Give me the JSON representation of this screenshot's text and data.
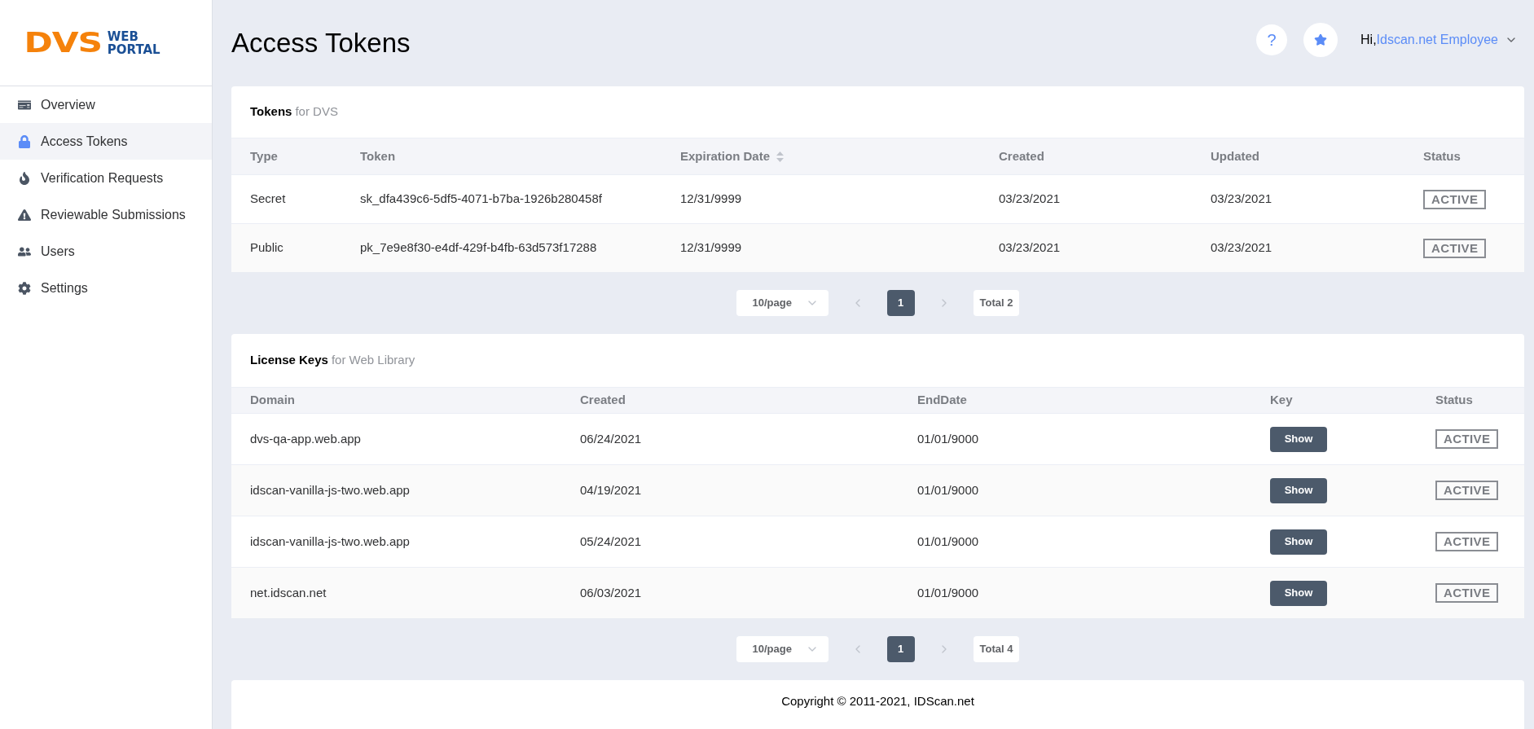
{
  "logo": {
    "mark": "DVS",
    "line_1": "WEB",
    "line_2": "PORTAL"
  },
  "sidebar": {
    "items": [
      {
        "label": "Overview",
        "selected": false
      },
      {
        "label": "Access Tokens",
        "selected": true
      },
      {
        "label": "Verification Requests",
        "selected": false
      },
      {
        "label": "Reviewable Submissions",
        "selected": false
      },
      {
        "label": "Users",
        "selected": false
      },
      {
        "label": "Settings",
        "selected": false
      }
    ]
  },
  "page_title": "Access Tokens",
  "header": {
    "help": "?",
    "greeting": "Hi,",
    "user": "Idscan.net Employee"
  },
  "tokens": {
    "title": "Tokens",
    "subtitle": "for DVS",
    "columns": [
      {
        "label": "Type",
        "sortable": false
      },
      {
        "label": "Token",
        "sortable": false
      },
      {
        "label": "Expiration Date",
        "sortable": true
      },
      {
        "label": "Created",
        "sortable": false
      },
      {
        "label": "Updated",
        "sortable": false
      },
      {
        "label": "Status",
        "sortable": false
      }
    ],
    "rows": [
      {
        "type": "Secret",
        "token": "sk_dfa439c6-5df5-4071-b7ba-1926b280458f",
        "expiration": "12/31/9999",
        "created": "03/23/2021",
        "updated": "03/23/2021",
        "status": "ACTIVE"
      },
      {
        "type": "Public",
        "token": "pk_7e9e8f30-e4df-429f-b4fb-63d573f17288",
        "expiration": "12/31/9999",
        "created": "03/23/2021",
        "updated": "03/23/2021",
        "status": "ACTIVE"
      }
    ],
    "pagination": {
      "page_size": "10/page",
      "pages": [
        {
          "label": "1",
          "selected": true
        }
      ],
      "total": "Total 2"
    }
  },
  "license_keys": {
    "title": "License Keys",
    "subtitle": "for Web Library",
    "columns": [
      "Domain",
      "Created",
      "EndDate",
      "Key",
      "Status"
    ],
    "rows": [
      {
        "domain": "dvs-qa-app.web.app",
        "created": "06/24/2021",
        "end_date": "01/01/9000",
        "key": "Show",
        "status": "ACTIVE"
      },
      {
        "domain": "idscan-vanilla-js-two.web.app",
        "created": "04/19/2021",
        "end_date": "01/01/9000",
        "key": "Show",
        "status": "ACTIVE"
      },
      {
        "domain": "idscan-vanilla-js-two.web.app",
        "created": "05/24/2021",
        "end_date": "01/01/9000",
        "key": "Show",
        "status": "ACTIVE"
      },
      {
        "domain": "net.idscan.net",
        "created": "06/03/2021",
        "end_date": "01/01/9000",
        "key": "Show",
        "status": "ACTIVE"
      }
    ],
    "pagination": {
      "page_size": "10/page",
      "pages": [
        {
          "label": "1",
          "selected": true
        }
      ],
      "total": "Total 4"
    }
  },
  "footer": "Copyright © 2011-2021, IDScan.net"
}
